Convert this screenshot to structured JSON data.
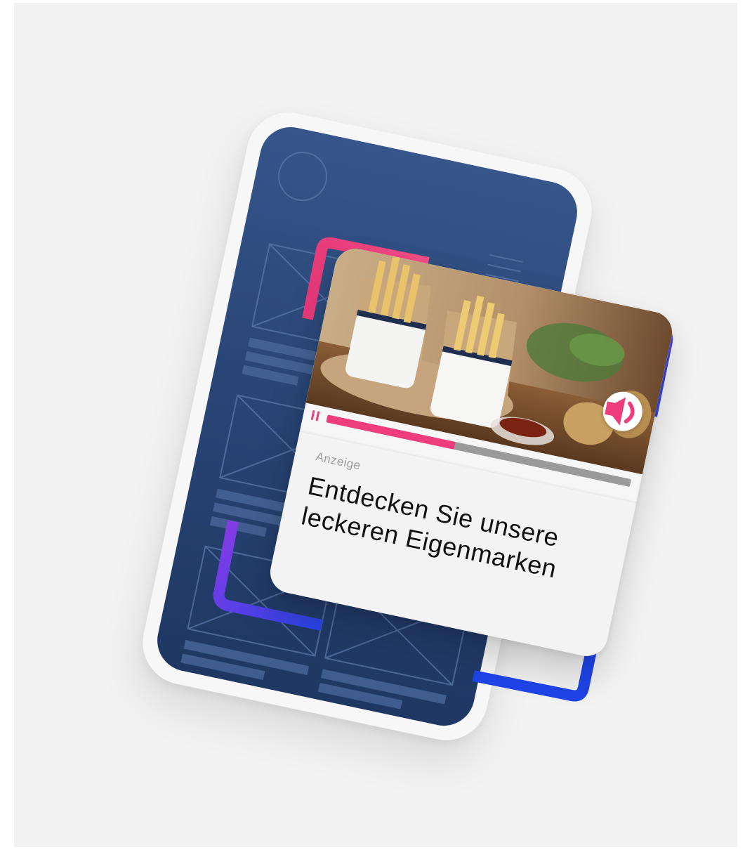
{
  "ad": {
    "label": "Anzeige",
    "title": "Entdecken Sie unsere leckeren Eigenmarken",
    "progress": 0.42,
    "state": "playing",
    "icons": {
      "mute": "speaker-icon",
      "pause": "pause-icon"
    }
  },
  "colors": {
    "background": "#f2f2f2",
    "screen": "#2a4677",
    "accent_pink": "#ee3d7c",
    "accent_purple": "#8b3ae6",
    "accent_blue": "#1f44e8"
  }
}
